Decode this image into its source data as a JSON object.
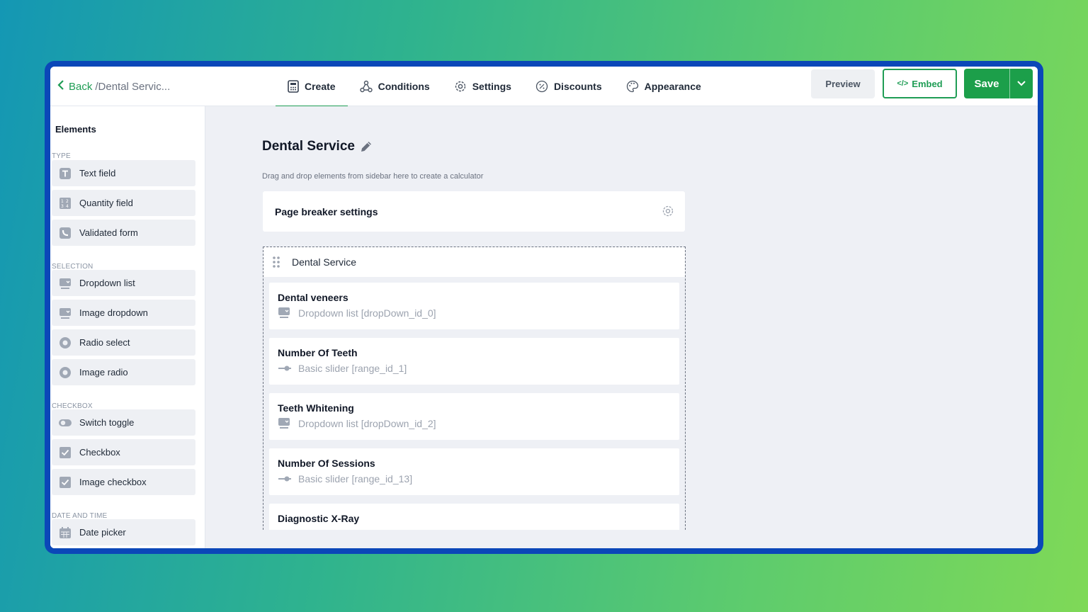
{
  "header": {
    "back_label": "Back",
    "breadcrumb": "/Dental Servic...",
    "tabs": [
      {
        "label": "Create",
        "icon": "calculator-icon",
        "active": true
      },
      {
        "label": "Conditions",
        "icon": "conditions-icon",
        "active": false
      },
      {
        "label": "Settings",
        "icon": "gear-icon",
        "active": false
      },
      {
        "label": "Discounts",
        "icon": "percent-icon",
        "active": false
      },
      {
        "label": "Appearance",
        "icon": "palette-icon",
        "active": false
      }
    ],
    "preview_label": "Preview",
    "embed_label": "Embed",
    "save_label": "Save"
  },
  "sidebar": {
    "title": "Elements",
    "sections": [
      {
        "label": "TYPE",
        "items": [
          {
            "label": "Text field",
            "icon": "text-icon"
          },
          {
            "label": "Quantity field",
            "icon": "quantity-icon"
          },
          {
            "label": "Validated form",
            "icon": "phone-icon"
          }
        ]
      },
      {
        "label": "SELECTION",
        "items": [
          {
            "label": "Dropdown list",
            "icon": "dropdown-icon"
          },
          {
            "label": "Image dropdown",
            "icon": "image-dropdown-icon"
          },
          {
            "label": "Radio select",
            "icon": "radio-icon"
          },
          {
            "label": "Image radio",
            "icon": "image-radio-icon"
          }
        ]
      },
      {
        "label": "CHECKBOX",
        "items": [
          {
            "label": "Switch toggle",
            "icon": "toggle-icon"
          },
          {
            "label": "Checkbox",
            "icon": "checkbox-icon"
          },
          {
            "label": "Image checkbox",
            "icon": "image-checkbox-icon"
          }
        ]
      },
      {
        "label": "DATE AND TIME",
        "items": [
          {
            "label": "Date picker",
            "icon": "calendar-icon"
          }
        ]
      }
    ]
  },
  "canvas": {
    "title": "Dental Service",
    "hint": "Drag and drop elements from sidebar here to create a calculator",
    "page_breaker_label": "Page breaker settings",
    "group_title": "Dental Service",
    "fields": [
      {
        "name": "Dental veneers",
        "meta": "Dropdown list [dropDown_id_0]",
        "icon": "dropdown-icon"
      },
      {
        "name": "Number Of Teeth",
        "meta": "Basic slider [range_id_1]",
        "icon": "slider-icon"
      },
      {
        "name": "Teeth Whitening",
        "meta": "Dropdown list [dropDown_id_2]",
        "icon": "dropdown-icon"
      },
      {
        "name": "Number Of Sessions",
        "meta": "Basic slider [range_id_13]",
        "icon": "slider-icon"
      },
      {
        "name": "Diagnostic X-Ray",
        "meta": "",
        "icon": ""
      }
    ]
  },
  "colors": {
    "accent": "#1f9d55",
    "frame": "#0b47b8",
    "canvas_bg": "#eef0f5"
  }
}
